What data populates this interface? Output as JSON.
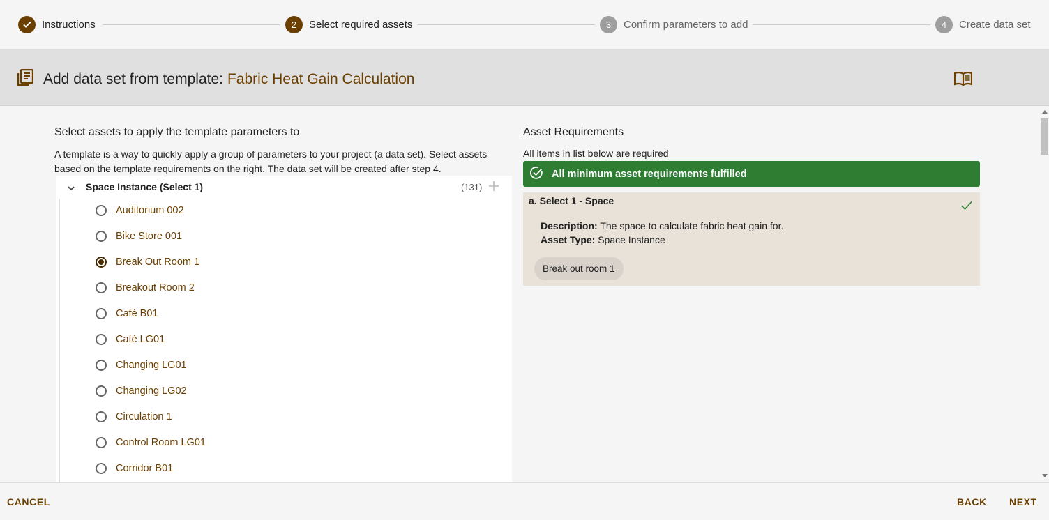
{
  "stepper": {
    "steps": [
      {
        "label": "Instructions",
        "status": "complete"
      },
      {
        "label": "Select required assets",
        "number": "2",
        "status": "active"
      },
      {
        "label": "Confirm parameters to add",
        "number": "3",
        "status": "pending"
      },
      {
        "label": "Create data set",
        "number": "4",
        "status": "pending"
      }
    ]
  },
  "header": {
    "prefix": "Add data set from template:",
    "template_name": "Fabric Heat Gain Calculation",
    "icons": [
      "library-books-icon",
      "book-open-icon"
    ]
  },
  "left": {
    "title": "Select assets to apply the template parameters to",
    "description": "A template is a way to quickly apply a group of parameters to your project (a data set). Select assets based on the template requirements on the right. The data set will be created after step 4.",
    "group": {
      "label": "Space Instance (Select 1)",
      "count": "(131)"
    },
    "items": [
      {
        "label": "Auditorium 002",
        "selected": false
      },
      {
        "label": "Bike Store 001",
        "selected": false
      },
      {
        "label": "Break Out Room 1",
        "selected": true
      },
      {
        "label": "Breakout Room 2",
        "selected": false
      },
      {
        "label": "Café B01",
        "selected": false
      },
      {
        "label": "Café LG01",
        "selected": false
      },
      {
        "label": "Changing LG01",
        "selected": false
      },
      {
        "label": "Changing LG02",
        "selected": false
      },
      {
        "label": "Circulation 1",
        "selected": false
      },
      {
        "label": "Control Room LG01",
        "selected": false
      },
      {
        "label": "Corridor B01",
        "selected": false
      }
    ]
  },
  "right": {
    "title": "Asset Requirements",
    "subtitle": "All items in list below are required",
    "status": "All minimum asset requirements fulfilled",
    "requirement": {
      "title": "a. Select 1 - Space",
      "description_label": "Description:",
      "description": "The space to calculate fabric heat gain for.",
      "type_label": "Asset Type:",
      "type": "Space Instance",
      "chip": "Break out room 1"
    }
  },
  "footer": {
    "cancel": "CANCEL",
    "back": "BACK",
    "next": "NEXT"
  },
  "colors": {
    "accent": "#6b3f00",
    "success": "#2e7d32",
    "card": "#e9e2d8"
  }
}
